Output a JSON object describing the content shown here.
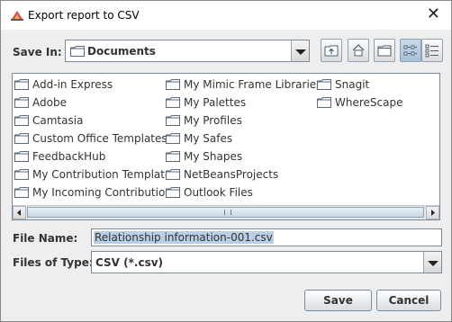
{
  "window": {
    "title": "Export report to CSV"
  },
  "save_in": {
    "label": "Save In:",
    "value": "Documents"
  },
  "toolbar": {
    "buttons": [
      {
        "icon": "up-one-level-icon"
      },
      {
        "icon": "home-icon"
      },
      {
        "icon": "new-folder-icon"
      },
      {
        "icon": "list-view-icon",
        "selected": true
      },
      {
        "icon": "details-view-icon"
      }
    ]
  },
  "files": {
    "columns": [
      [
        "Add-in Express",
        "Adobe",
        "Camtasia",
        "Custom Office Templates",
        "FeedbackHub",
        "My Contribution Templates",
        "My Incoming Contributions"
      ],
      [
        "My Mimic Frame Libraries",
        "My Palettes",
        "My Profiles",
        "My Safes",
        "My Shapes",
        "NetBeansProjects",
        "Outlook Files"
      ],
      [
        "Snagit",
        "WhereScape"
      ]
    ]
  },
  "file_name": {
    "label": "File Name:",
    "value": "Relationship information-001.csv"
  },
  "file_type": {
    "label": "Files of Type:",
    "value": "CSV (*.csv)"
  },
  "actions": {
    "save": "Save",
    "cancel": "Cancel"
  }
}
